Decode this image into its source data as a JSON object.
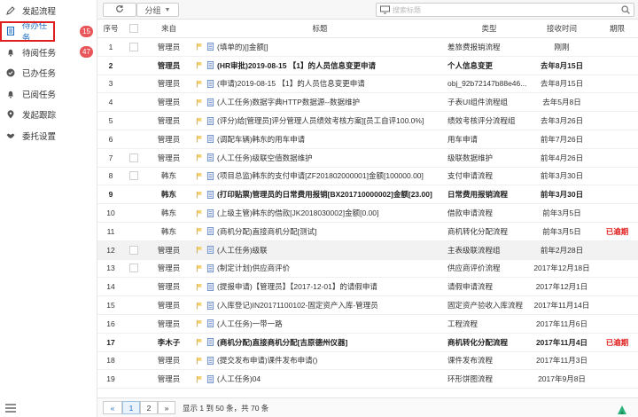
{
  "sidebar": {
    "items": [
      {
        "label": "发起流程",
        "icon": "edit-icon"
      },
      {
        "label": "待办任务",
        "icon": "document-icon",
        "badge": "15",
        "active": true
      },
      {
        "label": "待阅任务",
        "icon": "bell-icon",
        "badge": "47"
      },
      {
        "label": "已办任务",
        "icon": "check-circle-icon"
      },
      {
        "label": "已阅任务",
        "icon": "bell-icon"
      },
      {
        "label": "发起跟踪",
        "icon": "location-icon"
      },
      {
        "label": "委托设置",
        "icon": "handshake-icon"
      }
    ]
  },
  "toolbar": {
    "group_label": "分组",
    "search_placeholder": "搜索标题"
  },
  "table": {
    "headers": {
      "seq": "序号",
      "from": "来自",
      "title": "标题",
      "type": "类型",
      "time": "接收时间",
      "due": "期限"
    },
    "rows": [
      {
        "seq": "1",
        "from": "管理员",
        "title": "(填单的)[]金额[]",
        "type": "差旅费报销流程",
        "time": "刚刚",
        "due": "",
        "bold": false,
        "hl": false
      },
      {
        "seq": "2",
        "from": "管理员",
        "title": "(HR审批)2019-08-15 【1】的人员信息变更申请",
        "type": "个人信息变更",
        "time": "去年8月15日",
        "due": "",
        "bold": true,
        "hl": false
      },
      {
        "seq": "3",
        "from": "管理员",
        "title": "(申请)2019-08-15 【1】的人员信息变更申请",
        "type": "obj_92b72147b88e46...",
        "time": "去年8月15日",
        "due": "",
        "bold": false,
        "hl": false
      },
      {
        "seq": "4",
        "from": "管理员",
        "title": "(人工任务)数据字典HTTP数据源--数据维护",
        "type": "子表UI组件流程组",
        "time": "去年5月8日",
        "due": "",
        "bold": false,
        "hl": false
      },
      {
        "seq": "5",
        "from": "管理员",
        "title": "(评分)给[管理员]评分管理人员绩效考核方案][员工自评100.0%]",
        "type": "绩效考核评分流程组",
        "time": "去年3月26日",
        "due": "",
        "bold": false,
        "hl": false
      },
      {
        "seq": "6",
        "from": "管理员",
        "title": "(调配车辆)韩东的用车申请",
        "type": "用车申请",
        "time": "前年7月26日",
        "due": "",
        "bold": false,
        "hl": false
      },
      {
        "seq": "7",
        "from": "管理员",
        "title": "(人工任务)级联空值数据维护",
        "type": "级联数据维护",
        "time": "前年4月26日",
        "due": "",
        "bold": false,
        "hl": false
      },
      {
        "seq": "8",
        "from": "韩东",
        "title": "(项目总监)韩东的支付申请[ZF201802000001]金额[100000.00]",
        "type": "支付申请流程",
        "time": "前年3月30日",
        "due": "",
        "bold": false,
        "hl": false
      },
      {
        "seq": "9",
        "from": "韩东",
        "title": "(打印贴票)管理员的日常费用报销[BX201710000002]金额[23.00]",
        "type": "日常费用报销流程",
        "time": "前年3月30日",
        "due": "",
        "bold": true,
        "hl": false
      },
      {
        "seq": "10",
        "from": "韩东",
        "title": "(上级主管)韩东的借款[JK2018030002]金额[0.00]",
        "type": "借款申请流程",
        "time": "前年3月5日",
        "due": "",
        "bold": false,
        "hl": false
      },
      {
        "seq": "11",
        "from": "韩东",
        "title": "(商机分配)直接商机分配[测试]",
        "type": "商机转化分配流程",
        "time": "前年3月5日",
        "due": "已逾期",
        "bold": false,
        "hl": false
      },
      {
        "seq": "12",
        "from": "管理员",
        "title": "(人工任务)级联",
        "type": "主表级联流程组",
        "time": "前年2月28日",
        "due": "",
        "bold": false,
        "hl": true
      },
      {
        "seq": "13",
        "from": "管理员",
        "title": "(制定计划)供应商评价",
        "type": "供应商评价流程",
        "time": "2017年12月18日",
        "due": "",
        "bold": false,
        "hl": false
      },
      {
        "seq": "14",
        "from": "管理员",
        "title": "(提报申请)【管理员】【2017-12-01】的请假申请",
        "type": "请假申请流程",
        "time": "2017年12月1日",
        "due": "",
        "bold": false,
        "hl": false
      },
      {
        "seq": "15",
        "from": "管理员",
        "title": "(入库登记)IN20171100102-固定资产入库-管理员",
        "type": "固定资产验收入库流程",
        "time": "2017年11月14日",
        "due": "",
        "bold": false,
        "hl": false
      },
      {
        "seq": "16",
        "from": "管理员",
        "title": "(人工任务)一带一路",
        "type": "工程流程",
        "time": "2017年11月6日",
        "due": "",
        "bold": false,
        "hl": false
      },
      {
        "seq": "17",
        "from": "李木子",
        "title": "(商机分配)直接商机分配[吉原德州仪器]",
        "type": "商机转化分配流程",
        "time": "2017年11月4日",
        "due": "已逾期",
        "bold": true,
        "hl": false
      },
      {
        "seq": "18",
        "from": "管理员",
        "title": "(提交发布申请)课件发布申请()",
        "type": "课件发布流程",
        "time": "2017年11月3日",
        "due": "",
        "bold": false,
        "hl": false
      },
      {
        "seq": "19",
        "from": "管理员",
        "title": "(人工任务)04",
        "type": "环形饼图流程",
        "time": "2017年9月8日",
        "due": "",
        "bold": false,
        "hl": false
      }
    ]
  },
  "pager": {
    "prev": "«",
    "page1": "1",
    "page2": "2",
    "next": "»",
    "info": "显示 1 到 50 条，共 70 条"
  }
}
